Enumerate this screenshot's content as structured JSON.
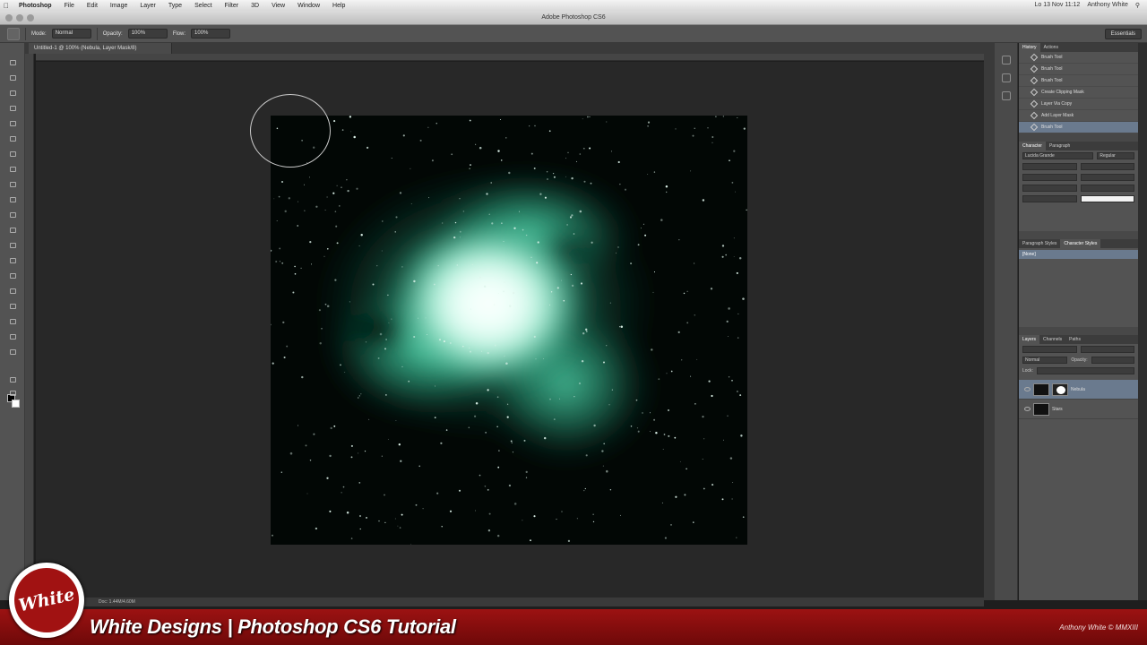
{
  "menubar": {
    "app": "Photoshop",
    "items": [
      "File",
      "Edit",
      "Image",
      "Layer",
      "Type",
      "Select",
      "Filter",
      "3D",
      "View",
      "Window",
      "Help"
    ],
    "clock": "Lo 13 Nov 11:12",
    "user": "Anthony White"
  },
  "window": {
    "title": "Adobe Photoshop CS6"
  },
  "options": {
    "mode_label": "Mode:",
    "mode_value": "Normal",
    "opacity_label": "Opacity:",
    "opacity_value": "100%",
    "flow_label": "Flow:",
    "flow_value": "100%",
    "workspace": "Essentials"
  },
  "document": {
    "tab": "Untitled-1 @ 100% (Nebula, Layer Mask/8)",
    "status": "Doc: 1.44M/4.60M"
  },
  "history": {
    "tabs": [
      "History",
      "Actions"
    ],
    "items": [
      "Brush Tool",
      "Brush Tool",
      "Brush Tool",
      "Create Clipping Mask",
      "Layer Via Copy",
      "Add Layer Mask",
      "Brush Tool"
    ]
  },
  "character": {
    "tabs": [
      "Character",
      "Paragraph"
    ],
    "font": "Lucida Grande",
    "style": "Regular"
  },
  "styles": {
    "tabs": [
      "Paragraph Styles",
      "Character Styles"
    ],
    "selected": "[None]"
  },
  "layers": {
    "tabs": [
      "Layers",
      "Channels",
      "Paths"
    ],
    "blend_mode": "Normal",
    "opacity_label": "Opacity:",
    "lock_label": "Lock:",
    "rows": [
      {
        "name": "Nebula",
        "selected": true
      },
      {
        "name": "Stars",
        "selected": false
      }
    ]
  },
  "banner": {
    "logo_text": "White",
    "title": "White Designs | Photoshop CS6 Tutorial",
    "credit": "Anthony White © MMXIII"
  },
  "colors": {
    "banner": "#8a0f0f",
    "nebula": "#3fbf98",
    "selection": "#6a7a8e"
  }
}
